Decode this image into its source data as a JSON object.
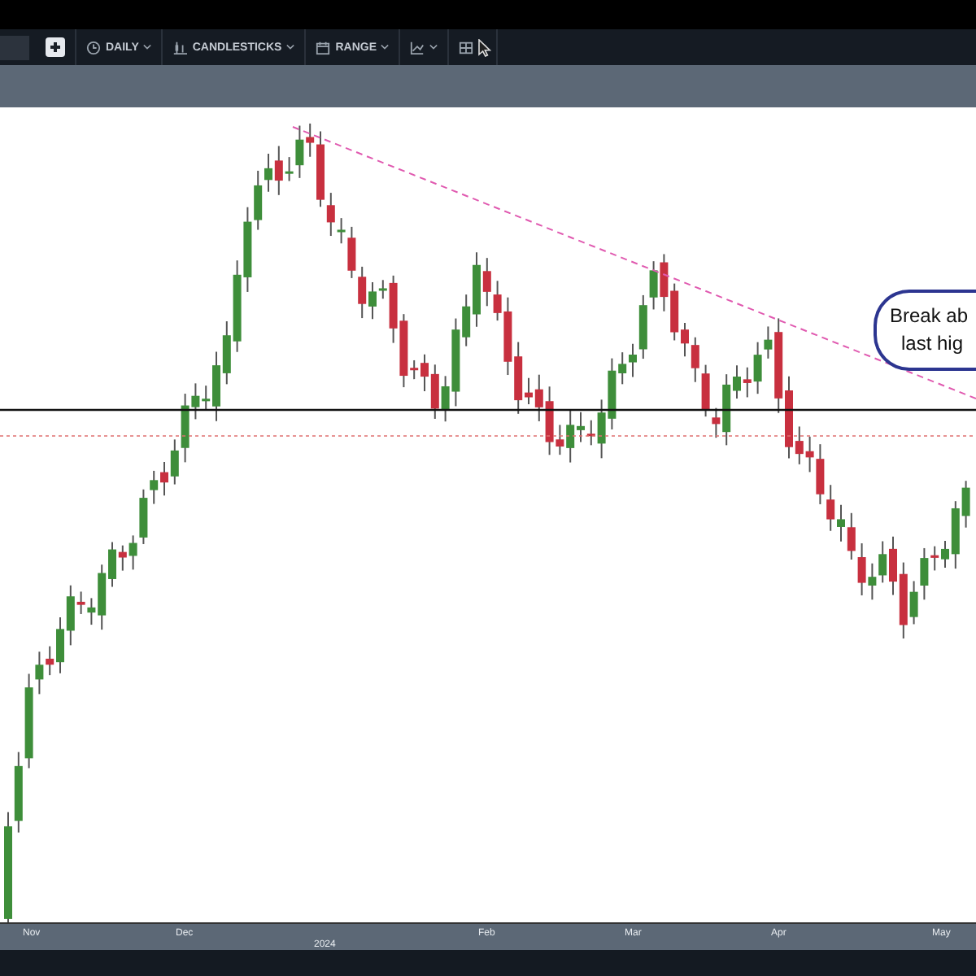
{
  "toolbar": {
    "buttons": [
      {
        "kind": "interval",
        "label": "DAILY"
      },
      {
        "kind": "chart_type",
        "label": "CANDLESTICKS"
      },
      {
        "kind": "range",
        "label": "RANGE"
      },
      {
        "kind": "indicators"
      },
      {
        "kind": "layout"
      }
    ]
  },
  "chart": {
    "annotation": {
      "lines": [
        "Break ab",
        "last hig"
      ]
    }
  },
  "time_axis": {
    "months": [
      "Nov",
      "Dec",
      "Feb",
      "Mar",
      "Apr",
      "May"
    ],
    "year": "2024"
  }
}
